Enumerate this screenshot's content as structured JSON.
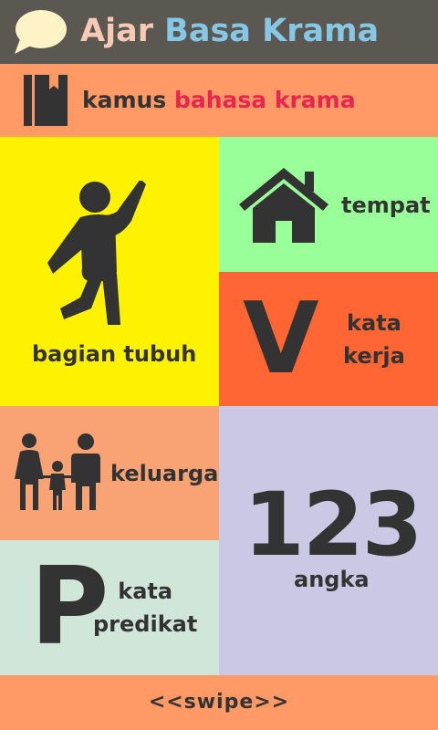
{
  "app": {
    "title_part1": "Ajar",
    "title_part2": "Basa Krama",
    "icon": "speech-bubble-icon"
  },
  "colors": {
    "header_bg": "#5b5851",
    "title_part1": "#f8c9b5",
    "title_part2": "#86c7e6",
    "accent_orange": "#ff9966",
    "accent_red": "#e8254f",
    "text_dark": "#333333"
  },
  "dictionary": {
    "label_part1": "kamus",
    "label_part2": "bahasa krama",
    "icon": "book-icon"
  },
  "tiles": [
    {
      "id": "body-parts",
      "label": "bagian tubuh",
      "icon": "jumping-person-icon",
      "color": "#fff200"
    },
    {
      "id": "places",
      "label": "tempat",
      "icon": "house-icon",
      "color": "#99ff99"
    },
    {
      "id": "verbs",
      "label_line1": "kata",
      "label_line2": "kerja",
      "glyph": "V",
      "color": "#ff6633"
    },
    {
      "id": "family",
      "label": "keluarga",
      "icon": "family-icon",
      "color": "#f9a374"
    },
    {
      "id": "numbers",
      "label": "angka",
      "glyph": "123",
      "color": "#cbc8e5"
    },
    {
      "id": "predicates",
      "label_line1": "kata",
      "label_line2": "predikat",
      "glyph": "P",
      "color": "#cfe6d9"
    }
  ],
  "footer": {
    "swipe_label": "<<swipe>>"
  }
}
